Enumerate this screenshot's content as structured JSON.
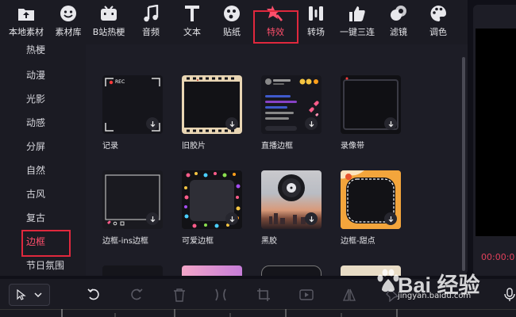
{
  "toolbar": {
    "items": [
      {
        "label": "本地素材",
        "icon": "upload-folder-icon"
      },
      {
        "label": "素材库",
        "icon": "smile-icon"
      },
      {
        "label": "B站热梗",
        "icon": "bilibili-tv-icon"
      },
      {
        "label": "音频",
        "icon": "music-note-icon"
      },
      {
        "label": "文本",
        "icon": "text-t-icon"
      },
      {
        "label": "贴纸",
        "icon": "sticker-face-icon"
      },
      {
        "label": "特效",
        "icon": "magic-star-icon"
      },
      {
        "label": "转场",
        "icon": "transition-icon"
      },
      {
        "label": "一键三连",
        "icon": "thumbs-up-icon"
      },
      {
        "label": "滤镜",
        "icon": "filter-icon"
      },
      {
        "label": "调色",
        "icon": "palette-icon"
      }
    ],
    "active": "特效"
  },
  "sidebar": {
    "items": [
      "热梗",
      "动漫",
      "光影",
      "动感",
      "分屏",
      "自然",
      "古风",
      "复古",
      "边框",
      "节日氛围"
    ],
    "active": "边框"
  },
  "effects": [
    {
      "caption": "记录",
      "badge": "REC"
    },
    {
      "caption": "旧胶片"
    },
    {
      "caption": "直播边框"
    },
    {
      "caption": "录像带"
    },
    {
      "caption": "边框-ins边框"
    },
    {
      "caption": "可爱边框"
    },
    {
      "caption": "黑胶"
    },
    {
      "caption": "边框-甜点"
    }
  ],
  "preview": {
    "timecode": "00:00:0"
  },
  "watermark": {
    "brand": "Bai 经验",
    "url": "jingyan.baidu.com"
  },
  "colors": {
    "accent": "#ff4f6b",
    "highlight_box": "#e0283d",
    "panel": "#1d1d26"
  }
}
